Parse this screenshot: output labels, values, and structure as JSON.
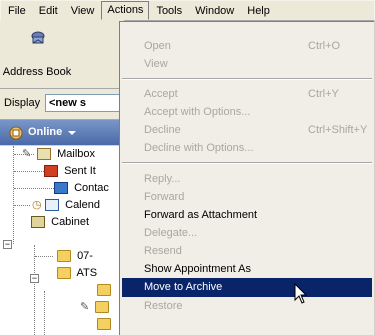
{
  "menubar": [
    "File",
    "Edit",
    "View",
    "Actions",
    "Tools",
    "Window",
    "Help"
  ],
  "toolbar": {
    "address_book": "Address Book"
  },
  "display": {
    "label": "Display",
    "value": "<new s"
  },
  "mode": {
    "label": "Online"
  },
  "tree": [
    "Mailbox",
    "Sent It",
    "Contac",
    "Calend",
    "Cabinet",
    "07-",
    "ATS"
  ],
  "menu": {
    "open": "Open",
    "open_sc": "Ctrl+O",
    "view": "View",
    "accept": "Accept",
    "accept_sc": "Ctrl+Y",
    "accept_opts": "Accept with Options...",
    "decline": "Decline",
    "decline_sc": "Ctrl+Shift+Y",
    "decline_opts": "Decline with Options...",
    "reply": "Reply...",
    "forward": "Forward",
    "forward_attach": "Forward as Attachment",
    "delegate": "Delegate...",
    "resend": "Resend",
    "show_appt": "Show Appointment As",
    "move_archive": "Move to Archive",
    "restore": "Restore"
  }
}
